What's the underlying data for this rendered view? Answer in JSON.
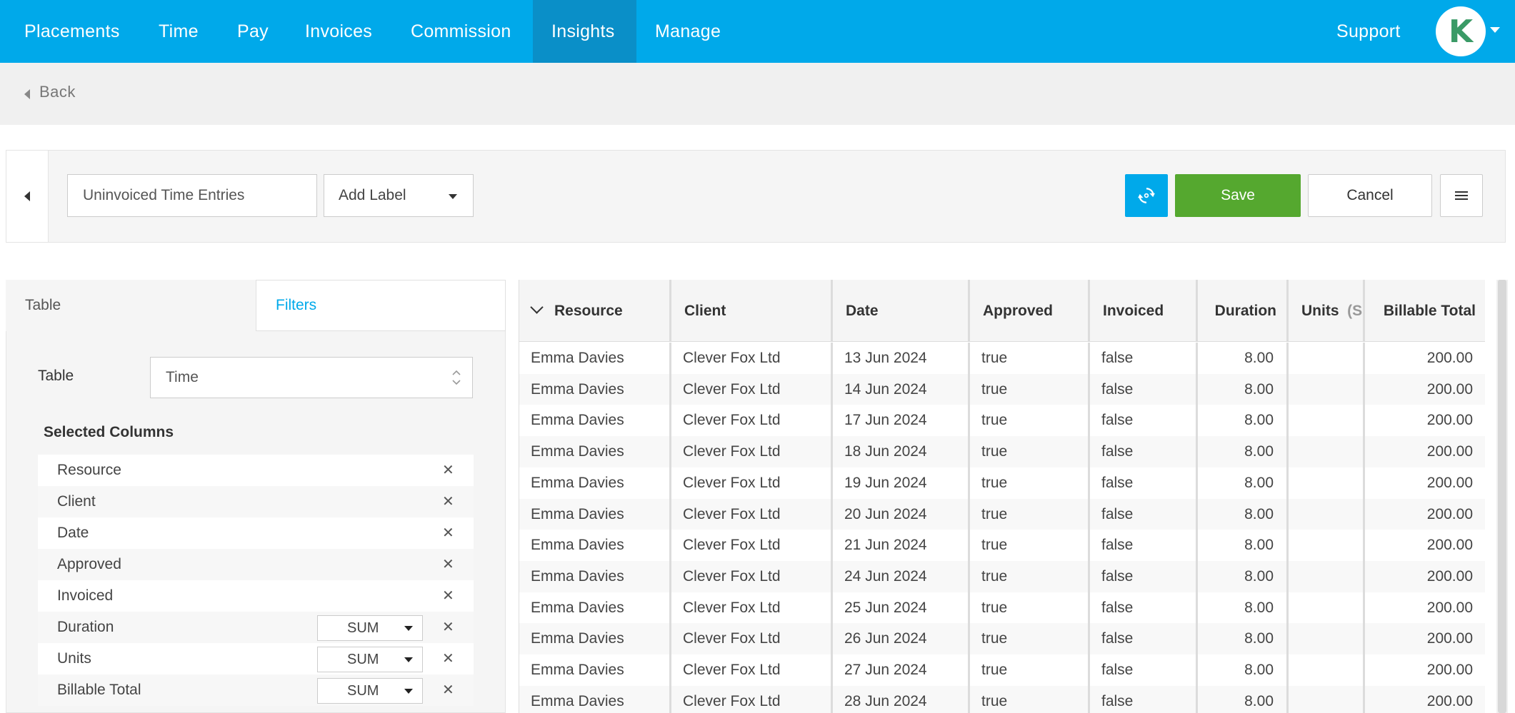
{
  "nav": {
    "items": [
      "Placements",
      "Time",
      "Pay",
      "Invoices",
      "Commission",
      "Insights",
      "Manage"
    ],
    "active": "Insights",
    "support": "Support",
    "avatar_letter": "K"
  },
  "back": {
    "label": "Back"
  },
  "toolbar": {
    "report_name": "Uninvoiced Time Entries",
    "label_select": "Add Label",
    "save_label": "Save",
    "cancel_label": "Cancel"
  },
  "left_panel": {
    "tabs": [
      "Table",
      "Filters"
    ],
    "active_tab": "Table",
    "table_label": "Table",
    "table_value": "Time",
    "selected_columns_title": "Selected Columns",
    "columns": [
      {
        "name": "Resource",
        "agg": null
      },
      {
        "name": "Client",
        "agg": null
      },
      {
        "name": "Date",
        "agg": null
      },
      {
        "name": "Approved",
        "agg": null
      },
      {
        "name": "Invoiced",
        "agg": null
      },
      {
        "name": "Duration",
        "agg": "SUM"
      },
      {
        "name": "Units",
        "agg": "SUM"
      },
      {
        "name": "Billable Total",
        "agg": "SUM"
      }
    ]
  },
  "grid": {
    "headers": [
      "Resource",
      "Client",
      "Date",
      "Approved",
      "Invoiced",
      "Duration",
      "Units",
      "Billable Total"
    ],
    "units_suffix": "(S",
    "rows": [
      [
        "Emma Davies",
        "Clever Fox Ltd",
        "13 Jun 2024",
        "true",
        "false",
        "8.00",
        "",
        "200.00"
      ],
      [
        "Emma Davies",
        "Clever Fox Ltd",
        "14 Jun 2024",
        "true",
        "false",
        "8.00",
        "",
        "200.00"
      ],
      [
        "Emma Davies",
        "Clever Fox Ltd",
        "17 Jun 2024",
        "true",
        "false",
        "8.00",
        "",
        "200.00"
      ],
      [
        "Emma Davies",
        "Clever Fox Ltd",
        "18 Jun 2024",
        "true",
        "false",
        "8.00",
        "",
        "200.00"
      ],
      [
        "Emma Davies",
        "Clever Fox Ltd",
        "19 Jun 2024",
        "true",
        "false",
        "8.00",
        "",
        "200.00"
      ],
      [
        "Emma Davies",
        "Clever Fox Ltd",
        "20 Jun 2024",
        "true",
        "false",
        "8.00",
        "",
        "200.00"
      ],
      [
        "Emma Davies",
        "Clever Fox Ltd",
        "21 Jun 2024",
        "true",
        "false",
        "8.00",
        "",
        "200.00"
      ],
      [
        "Emma Davies",
        "Clever Fox Ltd",
        "24 Jun 2024",
        "true",
        "false",
        "8.00",
        "",
        "200.00"
      ],
      [
        "Emma Davies",
        "Clever Fox Ltd",
        "25 Jun 2024",
        "true",
        "false",
        "8.00",
        "",
        "200.00"
      ],
      [
        "Emma Davies",
        "Clever Fox Ltd",
        "26 Jun 2024",
        "true",
        "false",
        "8.00",
        "",
        "200.00"
      ],
      [
        "Emma Davies",
        "Clever Fox Ltd",
        "27 Jun 2024",
        "true",
        "false",
        "8.00",
        "",
        "200.00"
      ],
      [
        "Emma Davies",
        "Clever Fox Ltd",
        "28 Jun 2024",
        "true",
        "false",
        "8.00",
        "",
        "200.00"
      ]
    ]
  },
  "colors": {
    "nav_bg": "#00a9ea",
    "nav_active": "#0a8fc8",
    "save_green": "#55a82f",
    "accent_blue": "#00a9ea"
  }
}
